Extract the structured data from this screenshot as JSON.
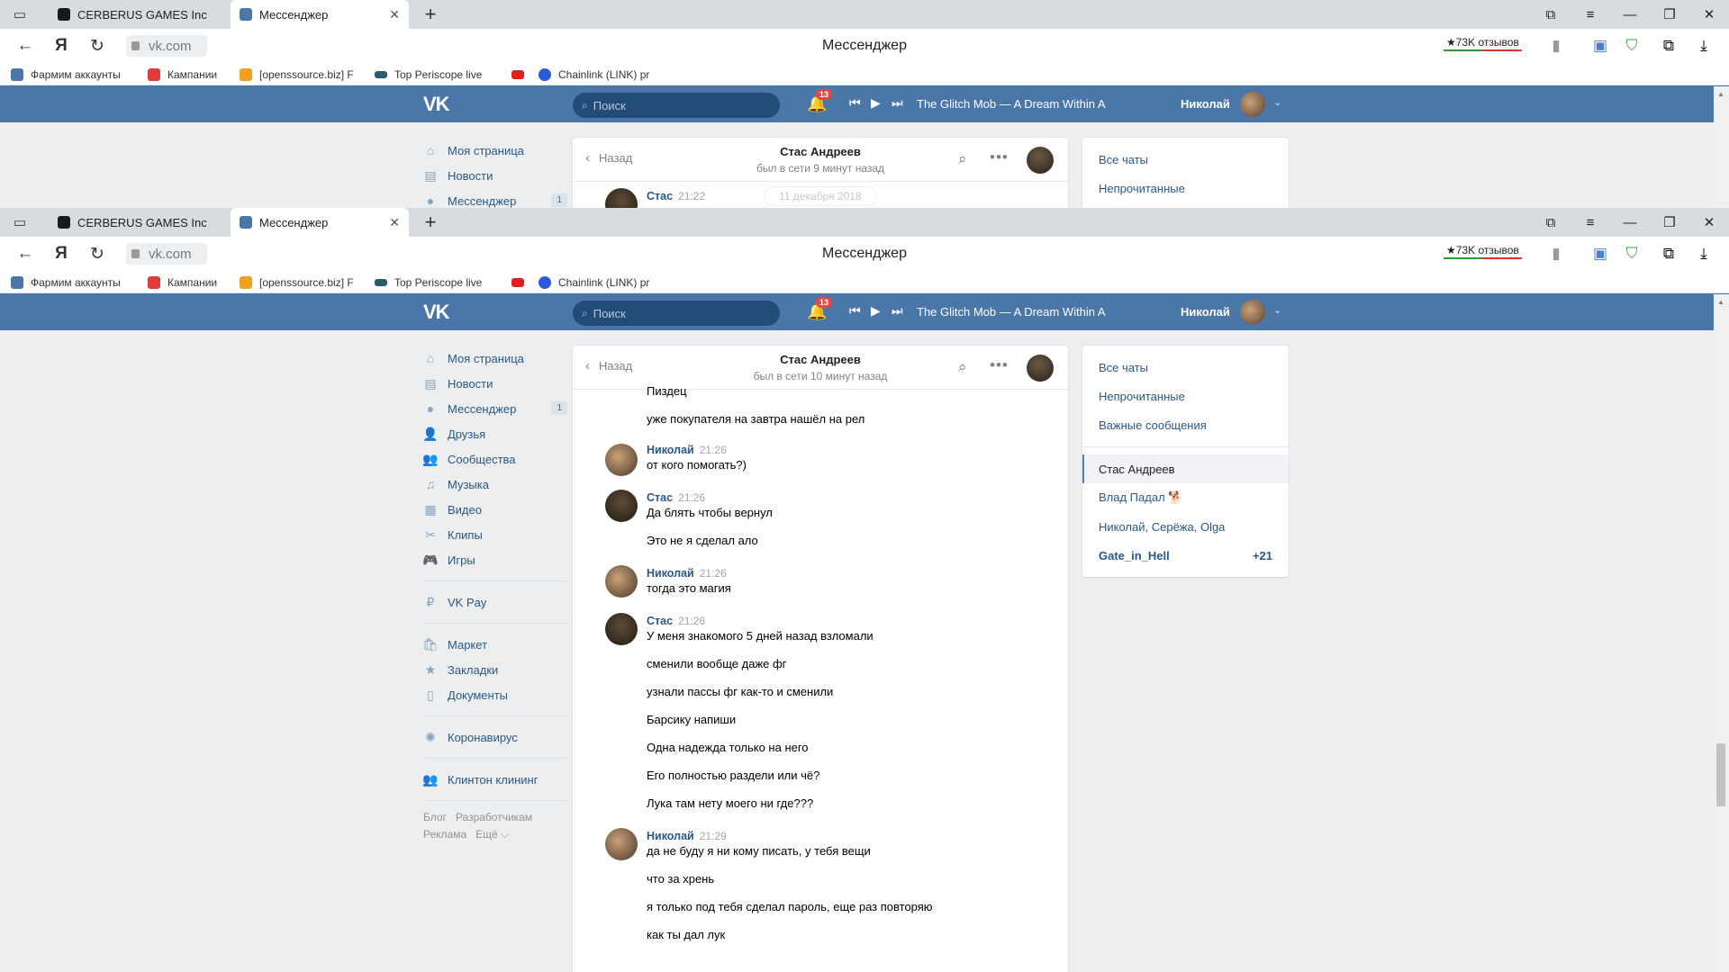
{
  "browser": {
    "tabs": [
      {
        "label": "CERBERUS GAMES Inc",
        "icon": "cerberus-favicon",
        "active": false
      },
      {
        "label": "Мессенджер",
        "icon": "vk-favicon",
        "active": true
      }
    ],
    "url": "vk.com",
    "page_title": "Мессенджер",
    "reviews": "★73K отзывов",
    "bookmarks": [
      "Фармим аккаунты",
      "Кампании",
      "[openssource.biz] F",
      "Top Periscope live",
      "",
      "Chainlink (LINK) pr"
    ]
  },
  "vk": {
    "search_placeholder": "Поиск",
    "notifications_count": "13",
    "track": "The Glitch Mob — A Dream Within A...",
    "user_name": "Николай"
  },
  "menu": {
    "items": [
      {
        "label": "Моя страница",
        "icon": "home-icon"
      },
      {
        "label": "Новости",
        "icon": "news-icon"
      },
      {
        "label": "Мессенджер",
        "icon": "messages-icon",
        "count": "1"
      },
      {
        "label": "Друзья",
        "icon": "friends-icon"
      },
      {
        "label": "Сообщества",
        "icon": "groups-icon"
      },
      {
        "label": "Музыка",
        "icon": "music-icon"
      },
      {
        "label": "Видео",
        "icon": "video-icon"
      },
      {
        "label": "Клипы",
        "icon": "clips-icon"
      },
      {
        "label": "Игры",
        "icon": "games-icon"
      },
      {
        "label": "VK Pay",
        "icon": "vkpay-icon"
      },
      {
        "label": "Маркет",
        "icon": "market-icon"
      },
      {
        "label": "Закладки",
        "icon": "bookmarks-icon"
      },
      {
        "label": "Документы",
        "icon": "documents-icon"
      },
      {
        "label": "Коронавирус",
        "icon": "coronavirus-icon"
      },
      {
        "label": "Клинтон клининг",
        "icon": "group-icon"
      }
    ],
    "footer": [
      "Блог",
      "Разработчикам",
      "Реклама",
      "Ещё ⌵"
    ]
  },
  "chat_top": {
    "back": "Назад",
    "name": "Стас Андреев",
    "status": "был в сети 9 минут назад",
    "peek_name": "Стас",
    "peek_time": "21:22",
    "peek_date": "11 декабря 2018"
  },
  "chat": {
    "back": "Назад",
    "name": "Стас Андреев",
    "status": "был в сети 10 минут назад",
    "orphan_lines": [
      "Пиздец",
      "уже покупателя на завтра нашёл на рел"
    ],
    "groups": [
      {
        "author": "Николай",
        "time": "21:26",
        "avatar": "n",
        "lines": [
          "от кого помогать?)"
        ]
      },
      {
        "author": "Стас",
        "time": "21:26",
        "avatar": "s",
        "lines": [
          "Да блять чтобы вернул",
          "Это не я сделал ало"
        ]
      },
      {
        "author": "Николай",
        "time": "21:26",
        "avatar": "n",
        "lines": [
          "тогда это магия"
        ]
      },
      {
        "author": "Стас",
        "time": "21:26",
        "avatar": "s",
        "lines": [
          "У меня знакомого 5 дней назад взломали",
          "сменили вообще даже фг",
          "узнали пассы фг как-то и сменили",
          "Барсику напиши",
          "Одна надежда только на него",
          "Его полностью раздели или чё?",
          "Лука там нету моего ни где???"
        ]
      },
      {
        "author": "Николай",
        "time": "21:29",
        "avatar": "n",
        "lines": [
          "да не буду я ни кому писать, у тебя вещи",
          "что за хрень",
          "я только под тебя сделал пароль, еще раз повторяю",
          "как ты дал лук"
        ]
      }
    ]
  },
  "right": {
    "filters": [
      "Все чаты",
      "Непрочитанные",
      "Важные сообщения"
    ],
    "chats": [
      {
        "label": "Стас Андреев",
        "selected": true,
        "bold": false,
        "count": ""
      },
      {
        "label": "Влад Падал 🐕",
        "selected": false,
        "bold": false,
        "count": ""
      },
      {
        "label": "Николай, Серёжа, Olga",
        "selected": false,
        "bold": false,
        "count": ""
      },
      {
        "label": "Gate_in_Hell",
        "selected": false,
        "bold": true,
        "count": "+21"
      }
    ]
  }
}
